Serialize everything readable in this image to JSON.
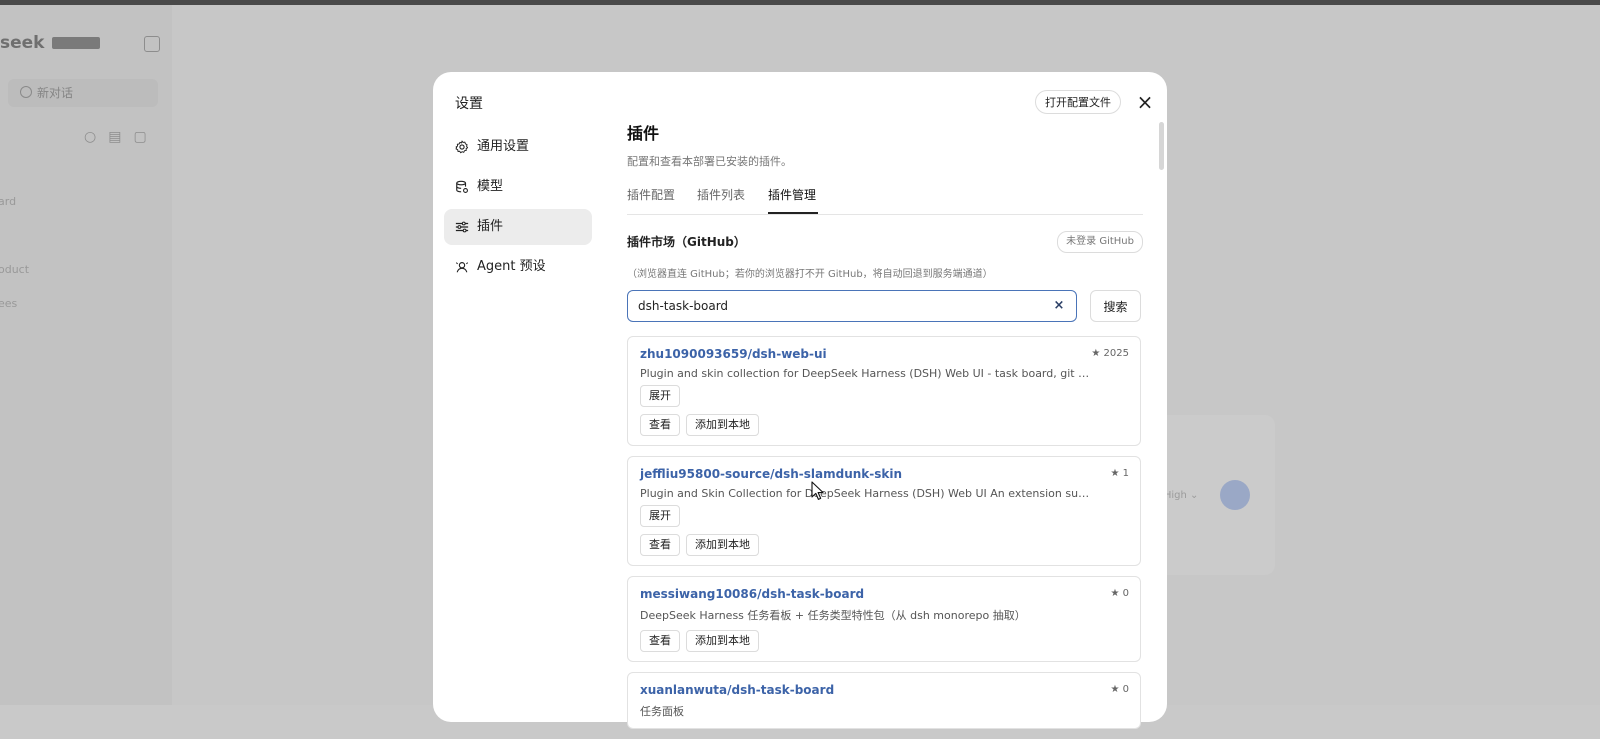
{
  "background": {
    "brand": "seek",
    "new_chat": "新对话"
  },
  "modal": {
    "title": "设置",
    "open_config_label": "打开配置文件",
    "close_label": "×",
    "nav": [
      {
        "label": "通用设置",
        "icon": "gear-icon",
        "active": false
      },
      {
        "label": "模型",
        "icon": "database-icon",
        "active": false
      },
      {
        "label": "插件",
        "icon": "sliders-icon",
        "active": true
      },
      {
        "label": "Agent 预设",
        "icon": "agent-icon",
        "active": false
      }
    ],
    "section": {
      "title": "插件",
      "description": "配置和查看本部署已安装的插件。"
    },
    "tabs": [
      {
        "label": "插件配置",
        "active": false
      },
      {
        "label": "插件列表",
        "active": false
      },
      {
        "label": "插件管理",
        "active": true
      }
    ],
    "market": {
      "title": "插件市场（GitHub）",
      "login_badge": "未登录 GitHub",
      "note": "（浏览器直连 GitHub；若你的浏览器打不开 GitHub，将自动回退到服务端通道）"
    },
    "search": {
      "value": "dsh-task-board",
      "clear_label": "×",
      "button_label": "搜索"
    },
    "results": [
      {
        "name": "zhu1090093659/dsh-web-ui",
        "stars": "★ 2025",
        "description": "Plugin and skin collection for DeepSeek Harness (DSH) Web UI - task board, git graph, righ...",
        "expand_label": "展开",
        "view_label": "查看",
        "add_label": "添加到本地"
      },
      {
        "name": "jeffliu95800-source/dsh-slamdunk-skin",
        "stars": "★ 1",
        "description": "Plugin and Skin Collection for DeepSeek Harness (DSH) Web UI An extension suite for DSH We...",
        "expand_label": "展开",
        "view_label": "查看",
        "add_label": "添加到本地"
      },
      {
        "name": "messiwang10086/dsh-task-board",
        "stars": "★ 0",
        "description": "DeepSeek Harness 任务看板 + 任务类型特性包（从 dsh monorepo 抽取）",
        "view_label": "查看",
        "add_label": "添加到本地"
      },
      {
        "name": "xuanlanwuta/dsh-task-board",
        "stars": "★ 0",
        "description": "任务面板"
      }
    ]
  },
  "colors": {
    "accent": "#3c63a8",
    "focus_border": "#4a74b8",
    "overlay": "#c9c9c9"
  }
}
